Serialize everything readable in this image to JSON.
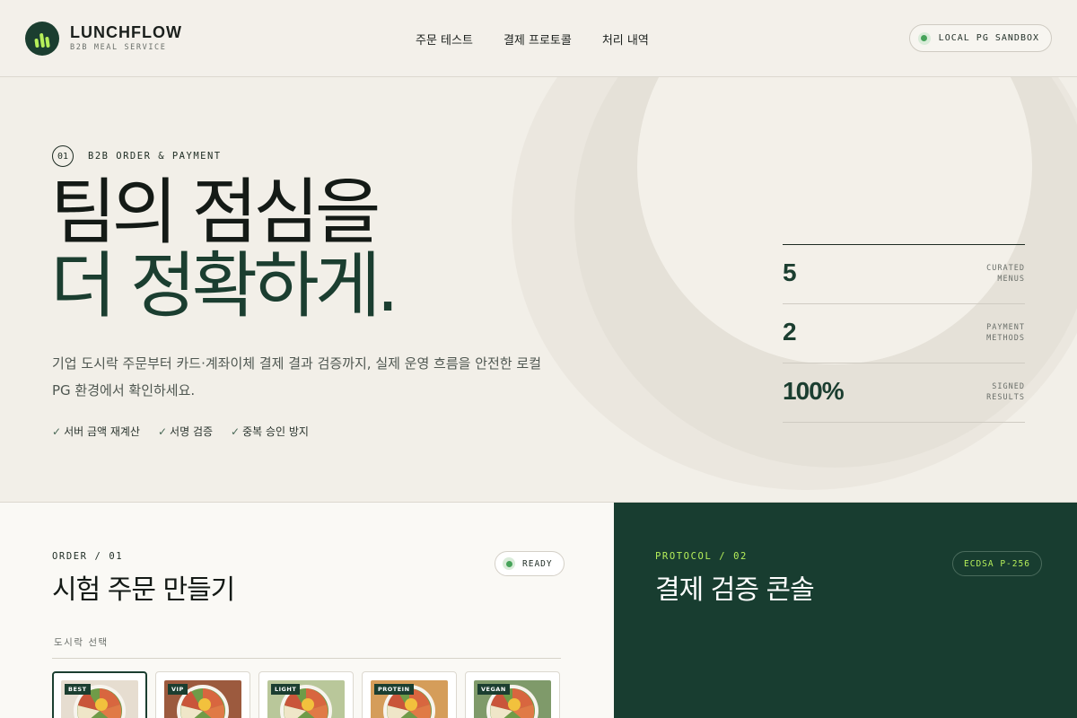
{
  "brand": {
    "name": "LUNCHFLOW",
    "tagline": "B2B MEAL SERVICE"
  },
  "nav": {
    "items": [
      "주문 테스트",
      "결제 프로토콜",
      "처리 내역"
    ]
  },
  "sandbox": {
    "label": "LOCAL PG SANDBOX"
  },
  "hero": {
    "step": "01",
    "eyebrow": "B2B ORDER & PAYMENT",
    "title_line1": "팀의 점심을",
    "title_line2": "더 정확하게.",
    "lead": "기업 도시락 주문부터 카드·계좌이체 결제 결과 검증까지, 실제 운영 흐름을 안전한 로컬 PG 환경에서 확인하세요.",
    "checks": [
      "서버 금액 재계산",
      "서명 검증",
      "중복 승인 방지"
    ]
  },
  "stats": [
    {
      "value": "5",
      "label_line1": "CURATED",
      "label_line2": "MENUS"
    },
    {
      "value": "2",
      "label_line1": "PAYMENT",
      "label_line2": "METHODS"
    },
    {
      "value": "100%",
      "label_line1": "SIGNED",
      "label_line2": "RESULTS"
    }
  ],
  "order": {
    "tag": "ORDER / 01",
    "title": "시험 주문 만들기",
    "status": "READY",
    "select_label": "도시락 선택",
    "menus": [
      {
        "badge": "BEST",
        "bg": "#e6ddd0",
        "selected": true
      },
      {
        "badge": "VIP",
        "bg": "#9c5a3e",
        "selected": false
      },
      {
        "badge": "LIGHT",
        "bg": "#b9c79a",
        "selected": false
      },
      {
        "badge": "PROTEIN",
        "bg": "#d59d5a",
        "selected": false
      },
      {
        "badge": "VEGAN",
        "bg": "#7f9a6a",
        "selected": false
      }
    ]
  },
  "protocol": {
    "tag": "PROTOCOL / 02",
    "title": "결제 검증 콘솔",
    "badge": "ECDSA P-256"
  },
  "colors": {
    "brand_green": "#1b3e30",
    "accent_lime": "#b6ef5a",
    "status_green": "#46a35a"
  }
}
